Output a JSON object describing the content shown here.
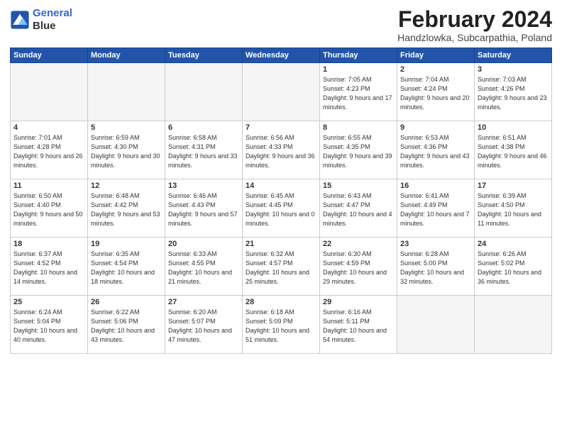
{
  "logo": {
    "line1": "General",
    "line2": "Blue"
  },
  "title": "February 2024",
  "location": "Handzlowka, Subcarpathia, Poland",
  "weekdays": [
    "Sunday",
    "Monday",
    "Tuesday",
    "Wednesday",
    "Thursday",
    "Friday",
    "Saturday"
  ],
  "weeks": [
    [
      {
        "day": "",
        "empty": true
      },
      {
        "day": "",
        "empty": true
      },
      {
        "day": "",
        "empty": true
      },
      {
        "day": "",
        "empty": true
      },
      {
        "day": "1",
        "rise": "7:05 AM",
        "set": "4:23 PM",
        "daylight": "9 hours and 17 minutes."
      },
      {
        "day": "2",
        "rise": "7:04 AM",
        "set": "4:24 PM",
        "daylight": "9 hours and 20 minutes."
      },
      {
        "day": "3",
        "rise": "7:03 AM",
        "set": "4:26 PM",
        "daylight": "9 hours and 23 minutes."
      }
    ],
    [
      {
        "day": "4",
        "rise": "7:01 AM",
        "set": "4:28 PM",
        "daylight": "9 hours and 26 minutes."
      },
      {
        "day": "5",
        "rise": "6:59 AM",
        "set": "4:30 PM",
        "daylight": "9 hours and 30 minutes."
      },
      {
        "day": "6",
        "rise": "6:58 AM",
        "set": "4:31 PM",
        "daylight": "9 hours and 33 minutes."
      },
      {
        "day": "7",
        "rise": "6:56 AM",
        "set": "4:33 PM",
        "daylight": "9 hours and 36 minutes."
      },
      {
        "day": "8",
        "rise": "6:55 AM",
        "set": "4:35 PM",
        "daylight": "9 hours and 39 minutes."
      },
      {
        "day": "9",
        "rise": "6:53 AM",
        "set": "4:36 PM",
        "daylight": "9 hours and 43 minutes."
      },
      {
        "day": "10",
        "rise": "6:51 AM",
        "set": "4:38 PM",
        "daylight": "9 hours and 46 minutes."
      }
    ],
    [
      {
        "day": "11",
        "rise": "6:50 AM",
        "set": "4:40 PM",
        "daylight": "9 hours and 50 minutes."
      },
      {
        "day": "12",
        "rise": "6:48 AM",
        "set": "4:42 PM",
        "daylight": "9 hours and 53 minutes."
      },
      {
        "day": "13",
        "rise": "6:46 AM",
        "set": "4:43 PM",
        "daylight": "9 hours and 57 minutes."
      },
      {
        "day": "14",
        "rise": "6:45 AM",
        "set": "4:45 PM",
        "daylight": "10 hours and 0 minutes."
      },
      {
        "day": "15",
        "rise": "6:43 AM",
        "set": "4:47 PM",
        "daylight": "10 hours and 4 minutes."
      },
      {
        "day": "16",
        "rise": "6:41 AM",
        "set": "4:49 PM",
        "daylight": "10 hours and 7 minutes."
      },
      {
        "day": "17",
        "rise": "6:39 AM",
        "set": "4:50 PM",
        "daylight": "10 hours and 11 minutes."
      }
    ],
    [
      {
        "day": "18",
        "rise": "6:37 AM",
        "set": "4:52 PM",
        "daylight": "10 hours and 14 minutes."
      },
      {
        "day": "19",
        "rise": "6:35 AM",
        "set": "4:54 PM",
        "daylight": "10 hours and 18 minutes."
      },
      {
        "day": "20",
        "rise": "6:33 AM",
        "set": "4:55 PM",
        "daylight": "10 hours and 21 minutes."
      },
      {
        "day": "21",
        "rise": "6:32 AM",
        "set": "4:57 PM",
        "daylight": "10 hours and 25 minutes."
      },
      {
        "day": "22",
        "rise": "6:30 AM",
        "set": "4:59 PM",
        "daylight": "10 hours and 29 minutes."
      },
      {
        "day": "23",
        "rise": "6:28 AM",
        "set": "5:00 PM",
        "daylight": "10 hours and 32 minutes."
      },
      {
        "day": "24",
        "rise": "6:26 AM",
        "set": "5:02 PM",
        "daylight": "10 hours and 36 minutes."
      }
    ],
    [
      {
        "day": "25",
        "rise": "6:24 AM",
        "set": "5:04 PM",
        "daylight": "10 hours and 40 minutes."
      },
      {
        "day": "26",
        "rise": "6:22 AM",
        "set": "5:06 PM",
        "daylight": "10 hours and 43 minutes."
      },
      {
        "day": "27",
        "rise": "6:20 AM",
        "set": "5:07 PM",
        "daylight": "10 hours and 47 minutes."
      },
      {
        "day": "28",
        "rise": "6:18 AM",
        "set": "5:09 PM",
        "daylight": "10 hours and 51 minutes."
      },
      {
        "day": "29",
        "rise": "6:16 AM",
        "set": "5:11 PM",
        "daylight": "10 hours and 54 minutes."
      },
      {
        "day": "",
        "empty": true
      },
      {
        "day": "",
        "empty": true
      }
    ]
  ],
  "labels": {
    "sunrise": "Sunrise:",
    "sunset": "Sunset:",
    "daylight": "Daylight:"
  }
}
